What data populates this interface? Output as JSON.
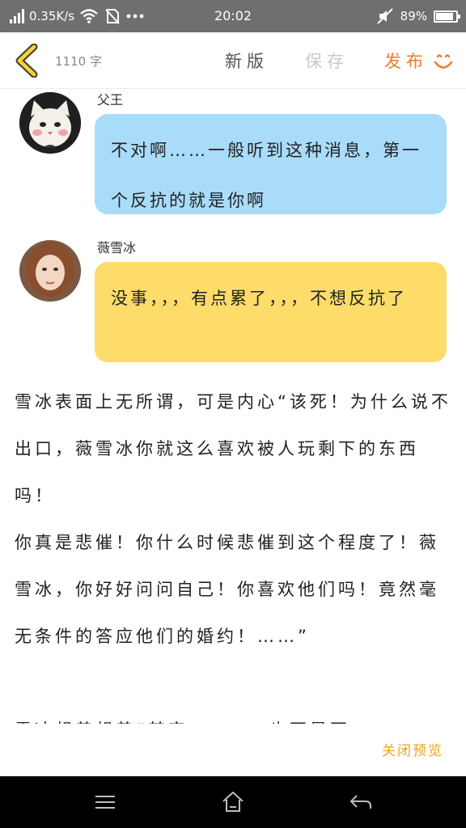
{
  "status_bar": {
    "network_speed": "0.35K/s",
    "time": "20:02",
    "battery": "89%",
    "battery_level": 0.89,
    "icons": [
      "signal-icon",
      "wifi-icon",
      "no-sim-icon",
      "more-icon",
      "mute-icon",
      "battery-icon"
    ]
  },
  "toolbar": {
    "back_icon": "chevron-left-icon",
    "word_count": "1110 字",
    "new_label": "新版",
    "save_label": "保存",
    "publish_label": "发布",
    "smile_icon": "smile-icon",
    "accent_color": "#f07a2e"
  },
  "messages": [
    {
      "name": "父王",
      "avatar_icon": "cat-avatar",
      "bubble_color": "#a9dcf9",
      "text": "不对啊……一般听到这种消息，第一个反抗的就是你啊"
    },
    {
      "name": "薇雪冰",
      "avatar_icon": "girl-avatar",
      "bubble_color": "#fddc6a",
      "text": "没事，，，有点累了，，，不想反抗了"
    }
  ],
  "paragraphs": [
    "雪冰表面上无所谓，可是内心“该死！为什么说不出口，薇雪冰你就这么喜欢被人玩剩下的东西吗！",
    "你真是悲催！你什么时候悲催到这个程度了！薇雪冰，你好好问问自己！你喜欢他们吗！竟然毫无条件的答应他们的婚约！……”",
    "雪冰想着想着“其实…………也不是不"
  ],
  "close_preview_label": "关闭预览",
  "nav_bar": {
    "icons": [
      "menu-icon",
      "home-icon",
      "back-icon"
    ]
  }
}
